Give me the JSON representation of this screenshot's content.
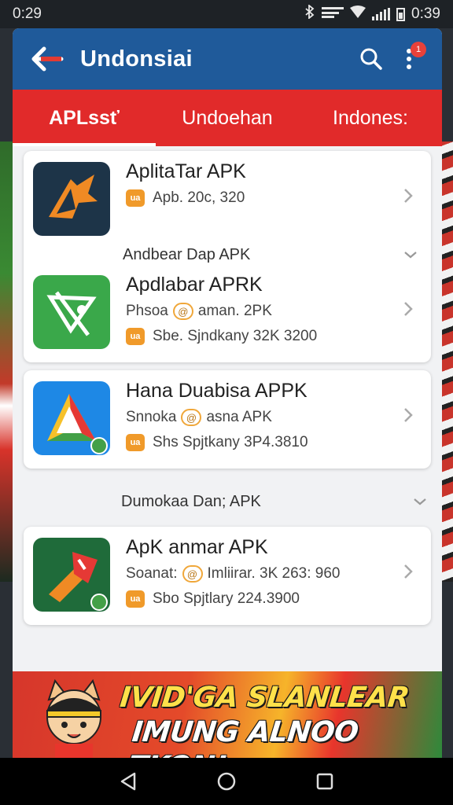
{
  "status_bar": {
    "time_left": "0:29",
    "time_right": "0:39",
    "signal_label": ""
  },
  "app_bar": {
    "title": "Undonsiai",
    "badge": "1"
  },
  "tabs": [
    {
      "label": "APLssť",
      "active": true
    },
    {
      "label": "Undoehan",
      "active": false
    },
    {
      "label": "Indones:",
      "active": false
    }
  ],
  "apps": [
    {
      "name": "AplitaTar APK",
      "meta1": "Apb. 20c, 320",
      "icon": "tan-fox-icon"
    },
    {
      "section": "Andbear Dap APK",
      "name": "Apdlabar APRK",
      "meta1_a": "Phsoa",
      "meta1_b": "aman.  2PK",
      "meta2": "Sbe. Sjndkany  32K 3200",
      "icon": "green-kite-icon"
    },
    {
      "name": "Hana Duabisa APPK",
      "meta1_a": "Snnoka",
      "meta1_b": "asna   APK",
      "meta2": "Shs  Spjtkany  3P4.3810",
      "icon": "triangle-play-icon"
    },
    {
      "section": "Dumokaa Dan; APK",
      "name": "ApK anmar APK",
      "meta1_a": "Soanat:",
      "meta1_b": "Imliirar.  3K 263: 960",
      "meta2": "Sbo  Spjtlary   224.3900",
      "icon": "red-flag-icon"
    }
  ],
  "promo": {
    "line1": "IVID'GA SLANLEAR",
    "line2": "IMUNG ALNOO TKON!"
  },
  "colors": {
    "app_bar": "#1f5a9a",
    "tabs": "#e12a2a",
    "accent_tag": "#f09a2a"
  }
}
